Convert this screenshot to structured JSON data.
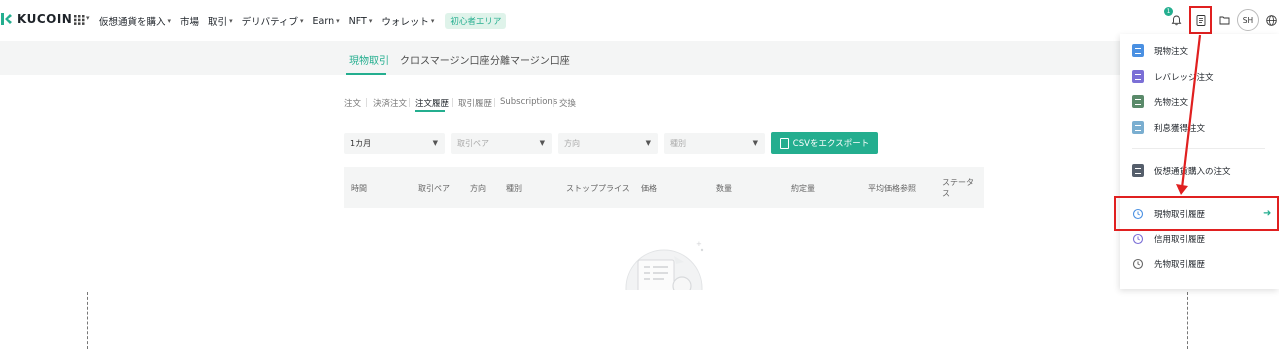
{
  "brand": {
    "name": "KUCOIN",
    "accent": "#24ae8f",
    "annotation_red": "#e02020"
  },
  "nav": {
    "items": [
      {
        "label": "仮想通貨を購入",
        "caret": true
      },
      {
        "label": "市場",
        "caret": false
      },
      {
        "label": "取引",
        "caret": true
      },
      {
        "label": "デリバティブ",
        "caret": true
      },
      {
        "label": "Earn",
        "caret": true
      },
      {
        "label": "NFT",
        "caret": true
      },
      {
        "label": "ウォレット",
        "caret": true
      }
    ],
    "beginner_badge": "初心者エリア",
    "notification_count": "1",
    "avatar_initials": "SH",
    "icons": [
      "apps-grid-icon",
      "bell-icon",
      "orders-icon",
      "wallet-icon",
      "globe-icon"
    ]
  },
  "subnav": {
    "tabs": [
      "現物取引",
      "クロスマージン口座",
      "分離マージン口座"
    ],
    "active_index": 0
  },
  "order_tabs": {
    "tabs": [
      "注文",
      "決済注文",
      "注文履歴",
      "取引履歴",
      "Subscriptions",
      "交換"
    ],
    "active_index": 2
  },
  "filters": {
    "period": "1カ月",
    "pair_placeholder": "取引ペア",
    "side_placeholder": "方向",
    "type_placeholder": "種別",
    "export_button": "CSVをエクスポート"
  },
  "table": {
    "headers": [
      "時間",
      "取引ペア",
      "方向",
      "種別",
      "ストッププライス",
      "価格",
      "数量",
      "約定量",
      "平均価格参照",
      "ステータス"
    ]
  },
  "dropdown": {
    "order_items": [
      {
        "label": "現物注文",
        "icon": "spot-order-icon",
        "color": "#4a90e2"
      },
      {
        "label": "レバレッジ注文",
        "icon": "margin-order-icon",
        "color": "#7b6fd6"
      },
      {
        "label": "先物注文",
        "icon": "futures-order-icon",
        "color": "#5a8a6a"
      },
      {
        "label": "利息獲得注文",
        "icon": "earn-order-icon",
        "color": "#7aaed0"
      }
    ],
    "buy_crypto_item": {
      "label": "仮想通貨購入の注文",
      "icon": "buy-crypto-order-icon",
      "color": "#555e6b"
    },
    "history_items": [
      {
        "label": "現物取引履歴",
        "icon": "spot-history-clock-icon",
        "color": "#4a90e2"
      },
      {
        "label": "信用取引履歴",
        "icon": "margin-history-clock-icon",
        "color": "#7b6fd6"
      },
      {
        "label": "先物取引履歴",
        "icon": "futures-history-clock-icon",
        "color": "#666"
      }
    ],
    "highlighted_index": 0
  }
}
